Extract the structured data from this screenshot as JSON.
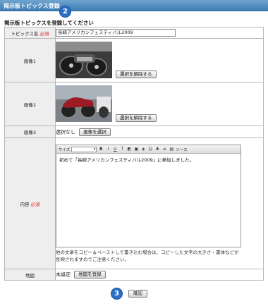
{
  "header": {
    "title": "掲示板トピックス登録"
  },
  "badges": {
    "step2": "2",
    "step3": "3"
  },
  "instruction": "掲示板トピックスを登録してください",
  "required_mark": "必須",
  "fields": {
    "topic_name": {
      "label": "トピックス名",
      "value": "長崎アメリカンフェスティバル2009"
    },
    "image1": {
      "label": "画像1",
      "button": "選択を解除する"
    },
    "image2": {
      "label": "画像2",
      "button": "選択を解除する"
    },
    "image3": {
      "label": "画像3",
      "status": "選択なし",
      "button": "画像を選択"
    },
    "content": {
      "label": "内容",
      "toolbar": {
        "size_label": "サイズ",
        "source_label": "ソース"
      },
      "text": "初めて「長崎アメリカンフェスティバル2009」に参加しました。",
      "note": "他の文章をコピー＆ペーストして書き込む場合は、コピーした文字の大きさ・書体などが反映されますのでご注意ください。"
    },
    "map": {
      "label": "地図",
      "status": "未設定",
      "button": "地図を登録"
    }
  },
  "confirm_button": "確認",
  "colors": {
    "header": "#4a85bb",
    "badge": "#2a6fc4",
    "required": "#dd2222"
  }
}
